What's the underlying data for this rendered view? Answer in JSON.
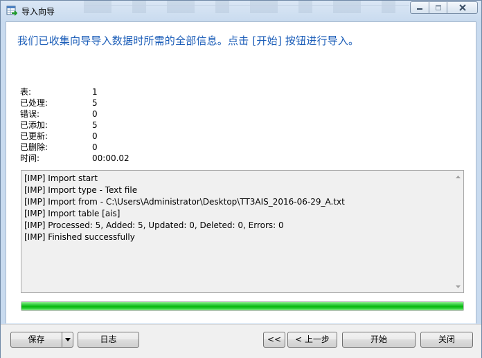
{
  "window": {
    "title": "导入向导",
    "icon": "import-wizard-icon"
  },
  "headline": "我们已收集向导导入数据时所需的全部信息。点击 [开始] 按钮进行导入。",
  "stats": [
    {
      "label": "表:",
      "value": "1"
    },
    {
      "label": "已处理:",
      "value": "5"
    },
    {
      "label": "错误:",
      "value": "0"
    },
    {
      "label": "已添加:",
      "value": "5"
    },
    {
      "label": "已更新:",
      "value": "0"
    },
    {
      "label": "已删除:",
      "value": "0"
    },
    {
      "label": "时间:",
      "value": "00:00.02"
    }
  ],
  "log": [
    "[IMP] Import start",
    "[IMP] Import type - Text file",
    "[IMP] Import from - C:\\Users\\Administrator\\Desktop\\TT3AIS_2016-06-29_A.txt",
    "[IMP] Import table [ais]",
    "[IMP] Processed: 5, Added: 5, Updated: 0, Deleted: 0, Errors: 0",
    "[IMP] Finished successfully"
  ],
  "progress": {
    "percent": 100
  },
  "buttons": {
    "save": "保存",
    "log": "日志",
    "first": "<<",
    "back": "< 上一步",
    "start": "开始",
    "close": "关闭"
  },
  "colors": {
    "headline": "#1b5db8",
    "progress": "#07b80e"
  }
}
